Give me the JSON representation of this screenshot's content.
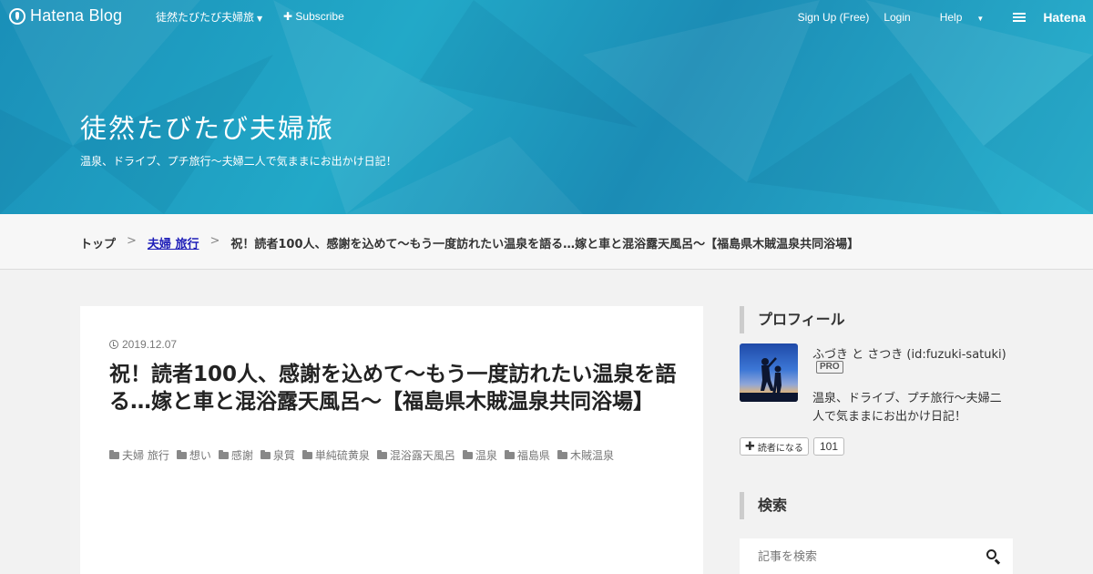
{
  "globalnav": {
    "logo_text": "Hatena Blog",
    "blog_menu": "徒然たびたび夫婦旅",
    "subscribe": "Subscribe",
    "signup": "Sign Up (Free)",
    "login": "Login",
    "help": "Help",
    "brand": "Hatena"
  },
  "header": {
    "title": "徒然たびたび夫婦旅",
    "description": "温泉、ドライブ、プチ旅行～夫婦二人で気ままにお出かけ日記！"
  },
  "breadcrumb": {
    "items": [
      "トップ",
      "夫婦 旅行",
      "祝！読者100人、感謝を込めて～もう一度訪れたい温泉を語る…嫁と車と混浴露天風呂～【福島県木賊温泉共同浴場】"
    ],
    "separator": ">"
  },
  "entry": {
    "date": "2019.12.07",
    "title": "祝！読者100人、感謝を込めて～もう一度訪れたい温泉を語る…嫁と車と混浴露天風呂～【福島県木賊温泉共同浴場】",
    "categories": [
      "夫婦 旅行",
      "想い",
      "感謝",
      "泉質",
      "単純硫黄泉",
      "混浴露天風呂",
      "温泉",
      "福島県",
      "木賊温泉"
    ]
  },
  "sidebar": {
    "profile_heading": "プロフィール",
    "profile_name": "ふづき と さつき (id:fuzuki-satuki)",
    "pro_badge": "PRO",
    "profile_desc": "温泉、ドライブ、プチ旅行～夫婦二人で気ままにお出かけ日記！",
    "reader_button": "読者になる",
    "reader_count": "101",
    "search_heading": "検索",
    "search_placeholder": "記事を検索"
  },
  "colors": {
    "banner": "#1f9ec2",
    "link": "#1d1db8",
    "background": "#f2f2f2"
  }
}
